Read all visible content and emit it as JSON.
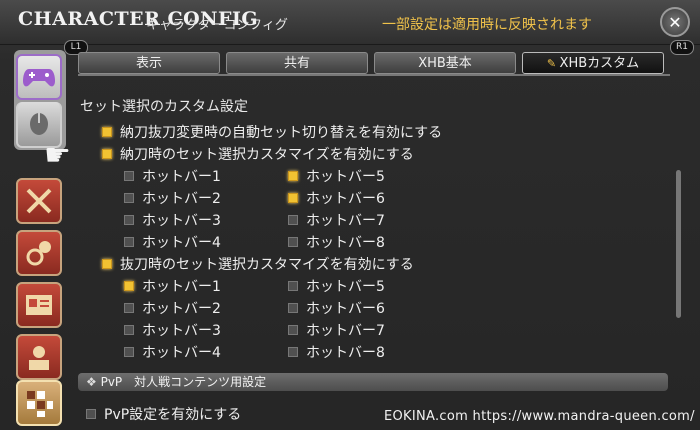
{
  "window": {
    "title_en": "CHARACTER CONFIG",
    "title_jp": "キャラクターコンフィグ",
    "notice": "一部設定は適用時に反映されます",
    "close_icon": "gear-close-icon",
    "lb_label": "L1",
    "rb_label": "R1"
  },
  "tabs": [
    {
      "label": "表示",
      "active": false
    },
    {
      "label": "共有",
      "active": false
    },
    {
      "label": "XHB基本",
      "active": false
    },
    {
      "label": "XHBカスタム",
      "active": true
    }
  ],
  "sidebar": {
    "items": [
      {
        "name": "gamepad-icon",
        "selected": true
      },
      {
        "name": "mouse-icon",
        "selected": false
      },
      {
        "name": "crossed-swords-icon",
        "selected": false
      },
      {
        "name": "item-gear-icon",
        "selected": false
      },
      {
        "name": "id-card-icon",
        "selected": false
      },
      {
        "name": "character-icon",
        "selected": false
      },
      {
        "name": "hotbar-icon",
        "selected": false
      }
    ]
  },
  "settings": {
    "section_title": "セット選択のカスタム設定",
    "auto_switch": {
      "label": "納刀抜刀変更時の自動セット切り替えを有効にする",
      "checked": true
    },
    "sheathed": {
      "label": "納刀時のセット選択カスタマイズを有効にする",
      "checked": true,
      "hotbars": [
        {
          "label": "ホットバー1",
          "checked": false
        },
        {
          "label": "ホットバー2",
          "checked": false
        },
        {
          "label": "ホットバー3",
          "checked": false
        },
        {
          "label": "ホットバー4",
          "checked": false
        },
        {
          "label": "ホットバー5",
          "checked": true
        },
        {
          "label": "ホットバー6",
          "checked": true
        },
        {
          "label": "ホットバー7",
          "checked": false
        },
        {
          "label": "ホットバー8",
          "checked": false
        }
      ]
    },
    "drawn": {
      "label": "抜刀時のセット選択カスタマイズを有効にする",
      "checked": true,
      "hotbars": [
        {
          "label": "ホットバー1",
          "checked": true
        },
        {
          "label": "ホットバー2",
          "checked": false
        },
        {
          "label": "ホットバー3",
          "checked": false
        },
        {
          "label": "ホットバー4",
          "checked": false
        },
        {
          "label": "ホットバー5",
          "checked": false
        },
        {
          "label": "ホットバー6",
          "checked": false
        },
        {
          "label": "ホットバー7",
          "checked": false
        },
        {
          "label": "ホットバー8",
          "checked": false
        }
      ]
    },
    "pvp_header": "PvP　対人戦コンテンツ用設定",
    "pvp_enable": {
      "label": "PvP設定を有効にする",
      "checked": false
    }
  },
  "watermark": "EOKINA.com  https://www.mandra-queen.com/",
  "colors": {
    "accent": "#f0c24a",
    "checkbox_on": "#f1c232"
  }
}
